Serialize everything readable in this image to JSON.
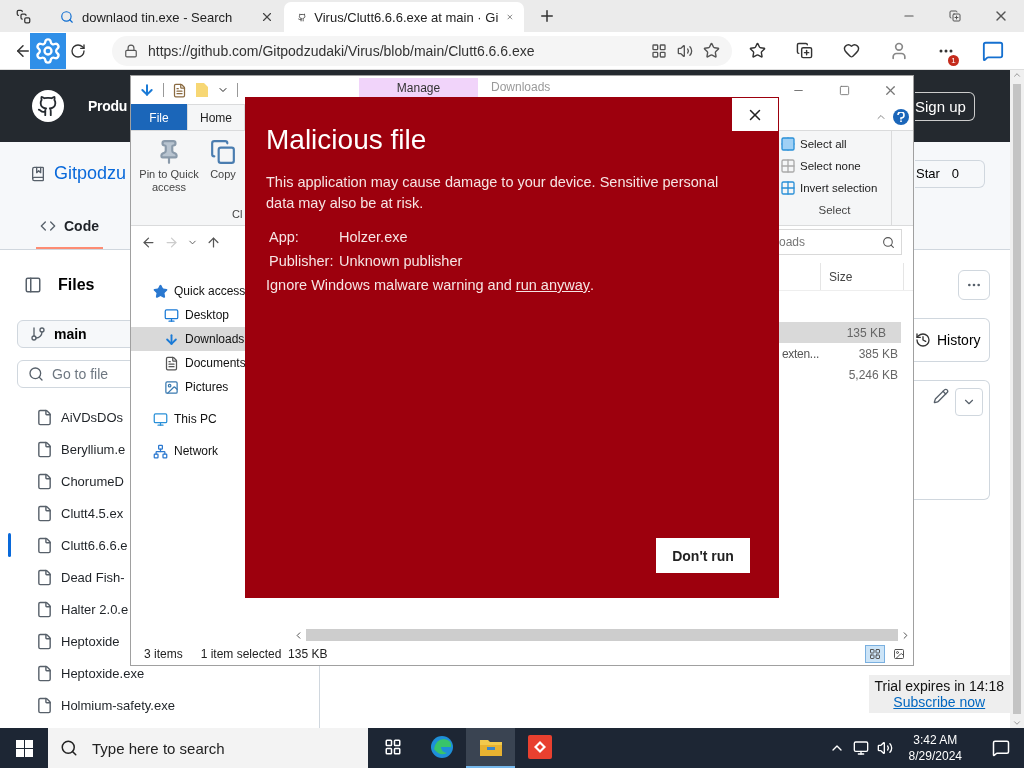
{
  "browser": {
    "tabs": [
      {
        "title": "downlaod tin.exe - Search",
        "kind": "search",
        "selected": false
      },
      {
        "title": "Virus/Clutt6.6.6.exe at main · Gi",
        "kind": "github",
        "selected": true
      }
    ],
    "url": "https://github.com/Gitpodzudaki/Virus/blob/main/Clutt6.6.6.exe",
    "menu_badge": "1"
  },
  "github": {
    "nav_label": "Produ",
    "sign_up": "Sign up",
    "repo": "Gitpodzu",
    "star_label": "Star",
    "star_count": "0",
    "tabs": [
      {
        "label": "Code",
        "selected": true
      }
    ],
    "files_title": "Files",
    "branch": "main",
    "search_placeholder": "Go to file",
    "files": [
      {
        "name": "AiVDsDOs",
        "selected": false
      },
      {
        "name": "Beryllium.e",
        "selected": false
      },
      {
        "name": "ChorumeD",
        "selected": false
      },
      {
        "name": "Clutt4.5.ex",
        "selected": false
      },
      {
        "name": "Clutt6.6.6.e",
        "selected": true
      },
      {
        "name": "Dead Fish-",
        "selected": false
      },
      {
        "name": "Halter 2.0.e",
        "selected": false
      },
      {
        "name": "Heptoxide",
        "selected": false
      },
      {
        "name": "Heptoxide.exe",
        "selected": false
      },
      {
        "name": "Holmium-safety.exe",
        "selected": false
      }
    ],
    "history": "History"
  },
  "explorer": {
    "context_tab": "Manage",
    "title": "Downloads",
    "ribbon_tabs": [
      {
        "label": "File",
        "kind": "file",
        "selected": false
      },
      {
        "label": "Home",
        "kind": "tab",
        "selected": true
      }
    ],
    "clipboard": [
      {
        "label": "Pin to Quick access",
        "kind": "pin"
      },
      {
        "label": "Copy",
        "kind": "copy"
      }
    ],
    "clipboard_group": "Cl",
    "select_items": [
      {
        "label": "Select all",
        "kind": "all"
      },
      {
        "label": "Select none",
        "kind": "none"
      },
      {
        "label": "Invert selection",
        "kind": "invert"
      }
    ],
    "select_group": "Select",
    "search_placeholder": "oads",
    "size_column": "Size",
    "rows": [
      {
        "size": "135 KB",
        "selected": true
      },
      {
        "type": "exten...",
        "size": "385 KB",
        "selected": false
      },
      {
        "size": "5,246 KB",
        "selected": false
      }
    ],
    "nav": [
      {
        "label": "Quick access",
        "kind": "star",
        "selected": false,
        "children": [
          {
            "label": "Desktop",
            "kind": "desktop",
            "selected": false
          },
          {
            "label": "Downloads",
            "kind": "downloads",
            "selected": true
          },
          {
            "label": "Documents",
            "kind": "documents",
            "selected": false
          },
          {
            "label": "Pictures",
            "kind": "pictures",
            "selected": false
          }
        ]
      },
      {
        "label": "This PC",
        "kind": "pc",
        "selected": false
      },
      {
        "label": "Network",
        "kind": "network",
        "selected": false
      }
    ],
    "status": {
      "count": "3 items",
      "selection": "1 item selected",
      "size": "135 KB"
    }
  },
  "dialog": {
    "title": "Malicious file",
    "message": "This application may cause damage to your device. Sensitive personal data may also be at risk.",
    "fields": [
      {
        "label": "App:",
        "value": "Holzer.exe"
      },
      {
        "label": "Publisher:",
        "value": "Unknown publisher"
      }
    ],
    "override_text": "Ignore Windows malware warning and",
    "override_link": "run anyway",
    "override_end": ".",
    "button": "Don't run"
  },
  "trial": {
    "text": "Trial expires in 14:18",
    "link": "Subscribe now"
  },
  "taskbar": {
    "search_placeholder": "Type here to search",
    "apps": [
      {
        "kind": "task-view",
        "active": false
      },
      {
        "kind": "edge",
        "active": false
      },
      {
        "kind": "explorer",
        "active": true
      },
      {
        "kind": "red-app",
        "active": false
      }
    ],
    "time": "3:42 AM",
    "date": "8/29/2024"
  }
}
